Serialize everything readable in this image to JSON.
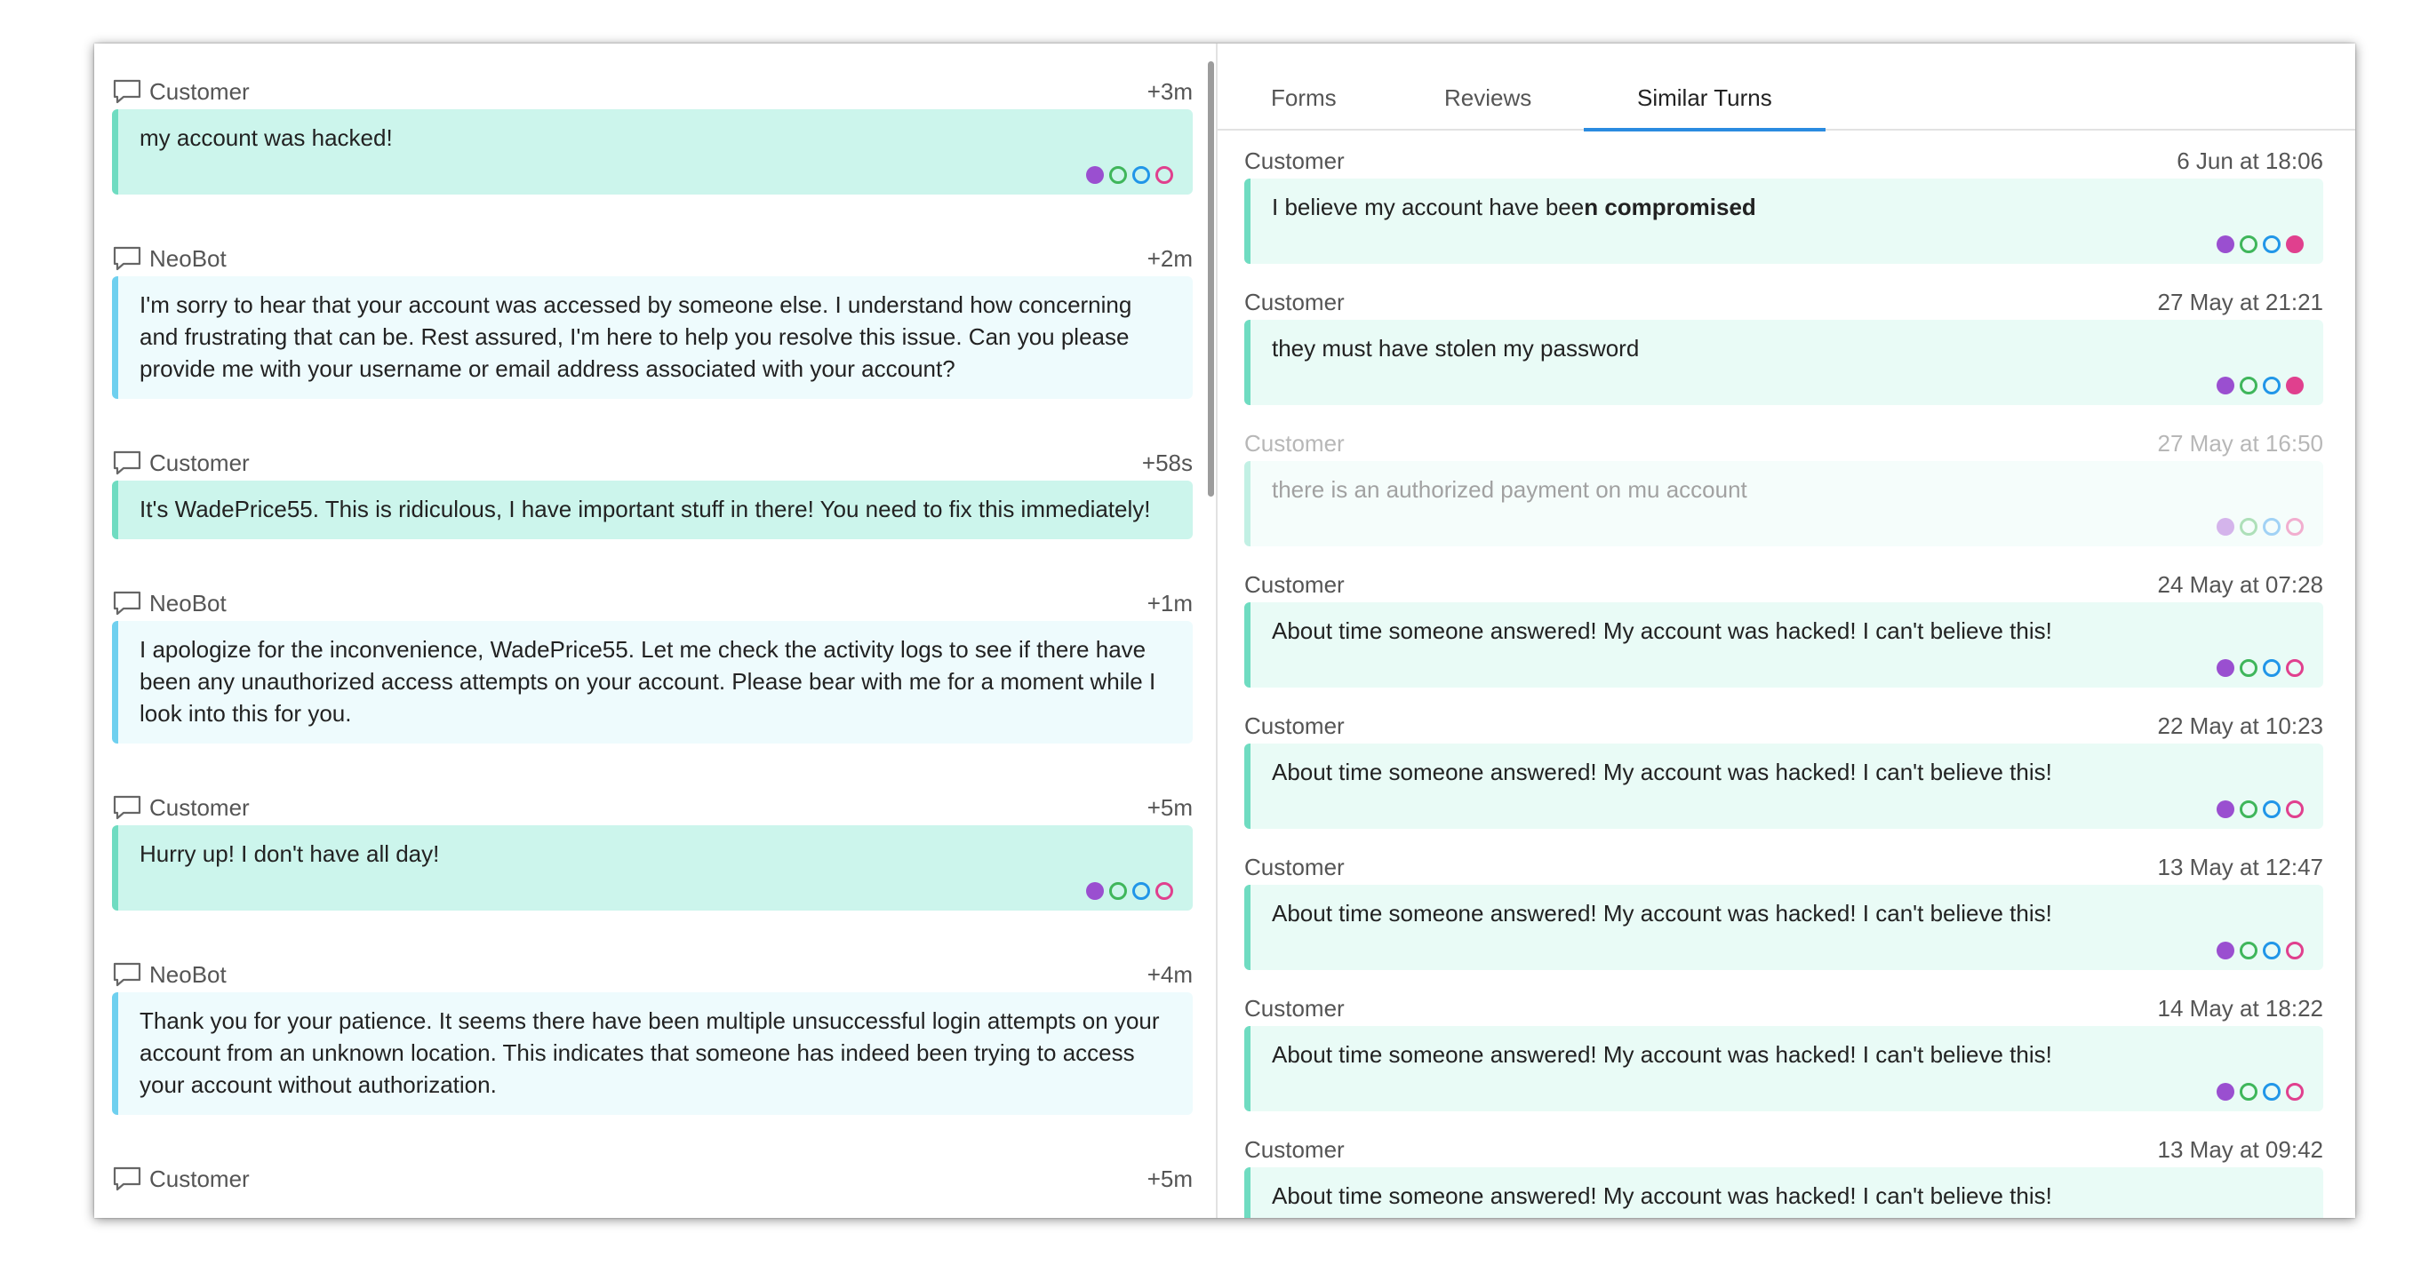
{
  "left": {
    "turns": [
      {
        "speaker": "Customer",
        "time": "+3m",
        "role": "customer",
        "text": "my account was hacked!",
        "dots": [
          "purple",
          "green",
          "blue",
          "pink"
        ]
      },
      {
        "speaker": "NeoBot",
        "time": "+2m",
        "role": "bot",
        "text": "I'm sorry to hear that your account was accessed by someone else. I understand how concerning and frustrating that can be. Rest assured, I'm here to help you resolve this issue. Can you please provide me with your username or email address associated with your account?"
      },
      {
        "speaker": "Customer",
        "time": "+58s",
        "role": "customer",
        "text": "It's WadePrice55. This is ridiculous, I have important stuff in there! You need to fix this immediately!"
      },
      {
        "speaker": "NeoBot",
        "time": "+1m",
        "role": "bot",
        "text": "I apologize for the inconvenience, WadePrice55. Let me check the activity logs to see if there have been any unauthorized access attempts on your account. Please bear with me for a moment while I look into this for you."
      },
      {
        "speaker": "Customer",
        "time": "+5m",
        "role": "customer",
        "text": "Hurry up! I don't have all day!",
        "dots": [
          "purple",
          "green",
          "blue",
          "pink"
        ]
      },
      {
        "speaker": "NeoBot",
        "time": "+4m",
        "role": "bot",
        "text": "Thank you for your patience. It seems there have been multiple unsuccessful login attempts on your account from an unknown location. This indicates that someone has indeed been trying to access your account without authorization."
      },
      {
        "speaker": "Customer",
        "time": "+5m",
        "role": "customer",
        "text": ""
      }
    ]
  },
  "tabs": [
    "Forms",
    "Reviews",
    "Similar Turns"
  ],
  "active_tab": "Similar Turns",
  "similar": [
    {
      "speaker": "Customer",
      "date": "6 Jun at 18:06",
      "text_pre": "I believe my account have bee",
      "text_bold": "n compromised",
      "pink_filled": true
    },
    {
      "speaker": "Customer",
      "date": "27 May at 21:21",
      "text_pre": "they must have stolen my password",
      "text_bold": "",
      "pink_filled": true
    },
    {
      "speaker": "Customer",
      "date": "27 May at 16:50",
      "text_pre": "there is an authorized payment on mu account",
      "text_bold": "",
      "faded": true
    },
    {
      "speaker": "Customer",
      "date": "24 May at 07:28",
      "text_pre": "About time someone answered! My account was hacked! I can't believe this!",
      "text_bold": ""
    },
    {
      "speaker": "Customer",
      "date": "22 May at 10:23",
      "text_pre": "About time someone answered! My account was hacked! I can't believe this!",
      "text_bold": ""
    },
    {
      "speaker": "Customer",
      "date": "13 May at 12:47",
      "text_pre": "About time someone answered! My account was hacked! I can't believe this!",
      "text_bold": ""
    },
    {
      "speaker": "Customer",
      "date": "14 May at 18:22",
      "text_pre": "About time someone answered! My account was hacked! I can't believe this!",
      "text_bold": ""
    },
    {
      "speaker": "Customer",
      "date": "13 May at 09:42",
      "text_pre": "About time someone answered! My account was hacked! I can't believe this!",
      "text_bold": ""
    }
  ],
  "icons": {
    "turn_icon": "chat-bubble-icon",
    "tag_dot": "tag-dot-icon"
  },
  "colors": {
    "purple": "#9a4fd0",
    "green": "#3fb65b",
    "blue": "#2196e8",
    "pink": "#e0408e",
    "tab_underline": "#2a8be0"
  }
}
